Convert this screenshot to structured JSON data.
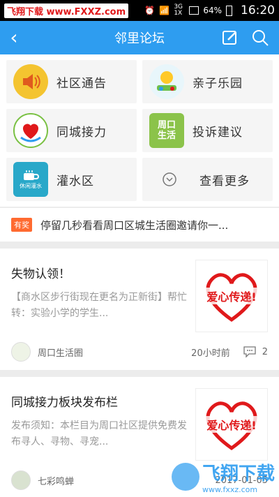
{
  "status_bar": {
    "watermark": "飞翔下载 www.FXXZ.com",
    "network": "3G 1X",
    "battery": "64%",
    "time": "16:20"
  },
  "header": {
    "title": "邻里论坛"
  },
  "grid": [
    {
      "label": "社区通告",
      "icon": "speaker-icon"
    },
    {
      "label": "亲子乐园",
      "icon": "family-icon"
    },
    {
      "label": "同城接力",
      "icon": "relay-icon"
    },
    {
      "label": "投诉建议",
      "icon": "zhoukou-icon",
      "icon_text": "周口生活"
    },
    {
      "label": "灌水区",
      "icon": "coffee-icon",
      "icon_text": "休闲灌水"
    },
    {
      "label": "查看更多",
      "icon": "chevron-down-icon"
    }
  ],
  "notice": {
    "badge": "有奖",
    "text": "停留几秒看看周口区城生活圈邀请你一..."
  },
  "posts": [
    {
      "title": "失物认领！",
      "desc": "【商水区步行街现在更名为正新街】帮忙转：实验小学的学生...",
      "thumb_text": "爱心传递!",
      "author": "周口生活圈",
      "time": "20小时前",
      "comments": "2"
    },
    {
      "title": "同城接力板块发布栏",
      "desc": "发布须知：本栏目为周口社区提供免费发布寻人、寻物、寻宠...",
      "thumb_text": "爱心传递!",
      "author": "七彩鸣蝉",
      "time": "2017-01-05"
    }
  ],
  "watermark_bottom": {
    "brand": "飞翔下载",
    "url": "www.fxxz.com"
  },
  "colors": {
    "accent": "#2e9df0",
    "badge": "#ff6a30",
    "heart": "#e0191b"
  }
}
